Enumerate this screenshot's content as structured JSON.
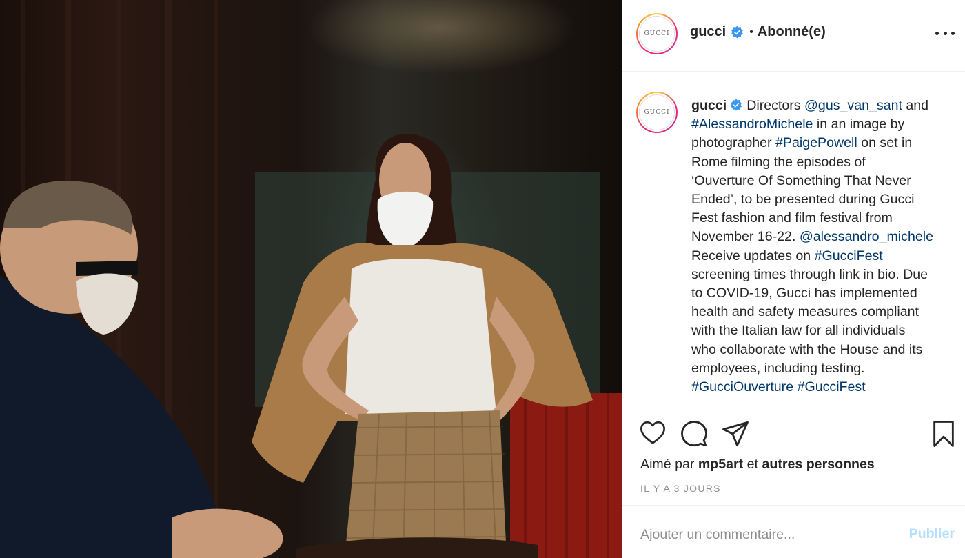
{
  "post": {
    "image_alt": "Gucci post photo",
    "author": {
      "username": "gucci",
      "avatar_text": "GUCCI",
      "verified_icon": "verified-badge-icon",
      "follow_separator": "•",
      "follow_status": "Abonné(e)"
    },
    "more_icon": "more-options-icon",
    "caption": {
      "username": "gucci",
      "lines": [
        [
          {
            "t": "Directors "
          },
          {
            "t": "@gus_van_sant",
            "link": true
          },
          {
            "t": " and"
          }
        ],
        [
          {
            "t": "#AlessandroMichele",
            "link": true
          },
          {
            "t": " in an image by"
          }
        ],
        [
          {
            "t": "photographer "
          },
          {
            "t": "#PaigePowell",
            "link": true
          },
          {
            "t": " on set in"
          }
        ],
        [
          {
            "t": "Rome filming the episodes of"
          }
        ],
        [
          {
            "t": "‘Ouverture Of Something That Never"
          }
        ],
        [
          {
            "t": "Ended’, to be presented during Gucci"
          }
        ],
        [
          {
            "t": "Fest fashion and film festival from"
          }
        ],
        [
          {
            "t": "November 16-22. "
          },
          {
            "t": "@alessandro_michele",
            "link": true
          }
        ],
        [
          {
            "t": "Receive updates on "
          },
          {
            "t": "#GucciFest",
            "link": true
          }
        ],
        [
          {
            "t": "screening times through link in bio. Due"
          }
        ],
        [
          {
            "t": "to COVID-19, Gucci has implemented"
          }
        ],
        [
          {
            "t": "health and safety measures compliant"
          }
        ],
        [
          {
            "t": "with the Italian law for all individuals"
          }
        ],
        [
          {
            "t": "who collaborate with the House and its"
          }
        ],
        [
          {
            "t": "employees, including testing."
          }
        ],
        [
          {
            "t": "#GucciOuverture",
            "link": true
          },
          {
            "t": " "
          },
          {
            "t": "#GucciFest",
            "link": true
          }
        ]
      ]
    },
    "actions": {
      "like_icon": "heart-icon",
      "comment_icon": "comment-icon",
      "share_icon": "paper-plane-icon",
      "save_icon": "bookmark-icon"
    },
    "likes": {
      "prefix": "Aimé par",
      "user": "mp5art",
      "middle": "et",
      "rest": "autres personnes"
    },
    "timestamp": "IL Y A 3 JOURS",
    "comment": {
      "placeholder": "Ajouter un commentaire...",
      "publish_label": "Publier"
    }
  },
  "colors": {
    "link": "#00376b",
    "verified": "#3897f0",
    "publish_disabled": "#b2dffc",
    "meta": "#8e8e8e",
    "divider": "#efefef"
  }
}
